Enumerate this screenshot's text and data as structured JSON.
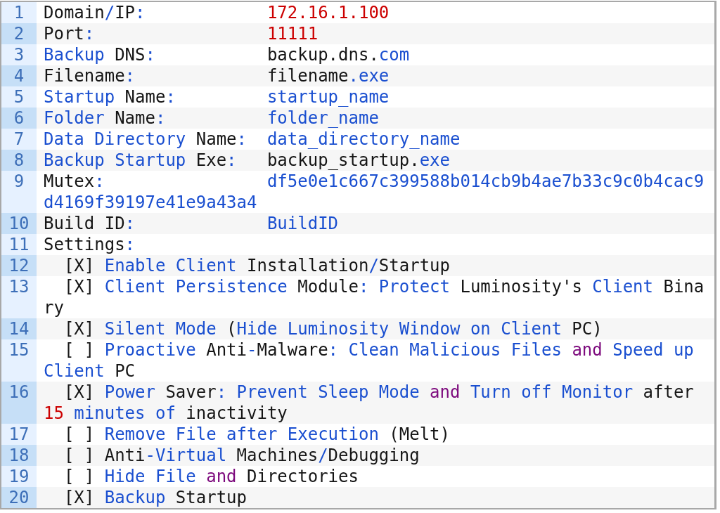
{
  "lines": [
    {
      "number": "1",
      "rows": [
        {
          "tokens": [
            {
              "kind": "plain",
              "text": "Domain"
            },
            {
              "kind": "keyword",
              "text": "/"
            },
            {
              "kind": "plain",
              "text": "IP"
            },
            {
              "kind": "keyword",
              "text": ":"
            },
            {
              "kind": "number",
              "text": "            172.16.1.100"
            }
          ]
        }
      ]
    },
    {
      "number": "2",
      "rows": [
        {
          "tokens": [
            {
              "kind": "plain",
              "text": "Port"
            },
            {
              "kind": "keyword",
              "text": ":"
            },
            {
              "kind": "number",
              "text": "                 11111"
            }
          ]
        }
      ]
    },
    {
      "number": "3",
      "rows": [
        {
          "tokens": [
            {
              "kind": "keyword",
              "text": "Backup"
            },
            {
              "kind": "plain",
              "text": " DNS"
            },
            {
              "kind": "keyword",
              "text": ":"
            },
            {
              "kind": "plain",
              "text": "           backup.dns."
            },
            {
              "kind": "keyword",
              "text": "com"
            }
          ]
        }
      ]
    },
    {
      "number": "4",
      "rows": [
        {
          "tokens": [
            {
              "kind": "plain",
              "text": "Filename"
            },
            {
              "kind": "keyword",
              "text": ":"
            },
            {
              "kind": "plain",
              "text": "             filename"
            },
            {
              "kind": "keyword",
              "text": ".exe"
            }
          ]
        }
      ]
    },
    {
      "number": "5",
      "rows": [
        {
          "tokens": [
            {
              "kind": "keyword",
              "text": "Startup"
            },
            {
              "kind": "plain",
              "text": " Name"
            },
            {
              "kind": "keyword",
              "text": ":"
            },
            {
              "kind": "keyword",
              "text": "         startup_name"
            }
          ]
        }
      ]
    },
    {
      "number": "6",
      "rows": [
        {
          "tokens": [
            {
              "kind": "keyword",
              "text": "Folder"
            },
            {
              "kind": "plain",
              "text": " Name"
            },
            {
              "kind": "keyword",
              "text": ":"
            },
            {
              "kind": "keyword",
              "text": "          folder_name"
            }
          ]
        }
      ]
    },
    {
      "number": "7",
      "rows": [
        {
          "tokens": [
            {
              "kind": "keyword",
              "text": "Data Directory"
            },
            {
              "kind": "plain",
              "text": " Name"
            },
            {
              "kind": "keyword",
              "text": ":"
            },
            {
              "kind": "keyword",
              "text": "  data_directory_name"
            }
          ]
        }
      ]
    },
    {
      "number": "8",
      "rows": [
        {
          "tokens": [
            {
              "kind": "keyword",
              "text": "Backup Startup"
            },
            {
              "kind": "plain",
              "text": " Exe"
            },
            {
              "kind": "keyword",
              "text": ":"
            },
            {
              "kind": "plain",
              "text": "   backup_startup."
            },
            {
              "kind": "keyword",
              "text": "exe"
            }
          ]
        }
      ]
    },
    {
      "number": "9",
      "rows": [
        {
          "tokens": [
            {
              "kind": "plain",
              "text": "Mutex"
            },
            {
              "kind": "keyword",
              "text": ":"
            },
            {
              "kind": "keyword",
              "text": "                df5e0e1c667c399588b014cb9b4ae7b33c9c0b4cac9"
            }
          ]
        },
        {
          "tokens": [
            {
              "kind": "keyword",
              "text": "d4169f39197e41e9a43a4"
            }
          ]
        }
      ]
    },
    {
      "number": "10",
      "rows": [
        {
          "tokens": [
            {
              "kind": "plain",
              "text": "Build ID"
            },
            {
              "kind": "keyword",
              "text": ":"
            },
            {
              "kind": "keyword",
              "text": "             BuildID"
            }
          ]
        }
      ]
    },
    {
      "number": "11",
      "rows": [
        {
          "tokens": [
            {
              "kind": "plain",
              "text": "Settings"
            },
            {
              "kind": "keyword",
              "text": ":"
            }
          ]
        }
      ]
    },
    {
      "number": "12",
      "rows": [
        {
          "tokens": [
            {
              "kind": "plain",
              "text": "  [X]"
            },
            {
              "kind": "keyword",
              "text": " Enable Client"
            },
            {
              "kind": "plain",
              "text": " Installation"
            },
            {
              "kind": "keyword",
              "text": "/"
            },
            {
              "kind": "plain",
              "text": "Startup"
            }
          ]
        }
      ]
    },
    {
      "number": "13",
      "rows": [
        {
          "tokens": [
            {
              "kind": "plain",
              "text": "  [X]"
            },
            {
              "kind": "keyword",
              "text": " Client Persistence"
            },
            {
              "kind": "plain",
              "text": " Module"
            },
            {
              "kind": "keyword",
              "text": ":"
            },
            {
              "kind": "keyword",
              "text": " Protect"
            },
            {
              "kind": "plain",
              "text": " Luminosity's"
            },
            {
              "kind": "keyword",
              "text": " Client"
            },
            {
              "kind": "plain",
              "text": " Bina"
            }
          ]
        },
        {
          "tokens": [
            {
              "kind": "plain",
              "text": "ry"
            }
          ]
        }
      ]
    },
    {
      "number": "14",
      "rows": [
        {
          "tokens": [
            {
              "kind": "plain",
              "text": "  [X]"
            },
            {
              "kind": "keyword",
              "text": " Silent Mode"
            },
            {
              "kind": "plain",
              "text": " ("
            },
            {
              "kind": "keyword",
              "text": "Hide Luminosity Window on Client"
            },
            {
              "kind": "plain",
              "text": " PC)"
            }
          ]
        }
      ]
    },
    {
      "number": "15",
      "rows": [
        {
          "tokens": [
            {
              "kind": "plain",
              "text": "  [ ]"
            },
            {
              "kind": "keyword",
              "text": " Proactive"
            },
            {
              "kind": "plain",
              "text": " Anti"
            },
            {
              "kind": "keyword",
              "text": "-"
            },
            {
              "kind": "plain",
              "text": "Malware"
            },
            {
              "kind": "keyword",
              "text": ":"
            },
            {
              "kind": "keyword",
              "text": " Clean Malicious Files"
            },
            {
              "kind": "operator",
              "text": " and"
            },
            {
              "kind": "keyword",
              "text": " Speed up"
            }
          ]
        },
        {
          "tokens": [
            {
              "kind": "keyword",
              "text": "Client"
            },
            {
              "kind": "plain",
              "text": " PC"
            }
          ]
        }
      ]
    },
    {
      "number": "16",
      "rows": [
        {
          "tokens": [
            {
              "kind": "plain",
              "text": "  [X]"
            },
            {
              "kind": "keyword",
              "text": " Power"
            },
            {
              "kind": "plain",
              "text": " Saver"
            },
            {
              "kind": "keyword",
              "text": ":"
            },
            {
              "kind": "keyword",
              "text": " Prevent Sleep Mode"
            },
            {
              "kind": "operator",
              "text": " and"
            },
            {
              "kind": "keyword",
              "text": " Turn off Monitor"
            },
            {
              "kind": "plain",
              "text": " after"
            }
          ]
        },
        {
          "tokens": [
            {
              "kind": "number",
              "text": "15"
            },
            {
              "kind": "keyword",
              "text": " minutes of"
            },
            {
              "kind": "plain",
              "text": " inactivity"
            }
          ]
        }
      ]
    },
    {
      "number": "17",
      "rows": [
        {
          "tokens": [
            {
              "kind": "plain",
              "text": "  [ ]"
            },
            {
              "kind": "keyword",
              "text": " Remove File after Execution"
            },
            {
              "kind": "plain",
              "text": " (Melt)"
            }
          ]
        }
      ]
    },
    {
      "number": "18",
      "rows": [
        {
          "tokens": [
            {
              "kind": "plain",
              "text": "  [ ] Anti"
            },
            {
              "kind": "keyword",
              "text": "-Virtual"
            },
            {
              "kind": "plain",
              "text": " Machines"
            },
            {
              "kind": "keyword",
              "text": "/"
            },
            {
              "kind": "plain",
              "text": "Debugging"
            }
          ]
        }
      ]
    },
    {
      "number": "19",
      "rows": [
        {
          "tokens": [
            {
              "kind": "plain",
              "text": "  [ ]"
            },
            {
              "kind": "keyword",
              "text": " Hide File"
            },
            {
              "kind": "operator",
              "text": " and"
            },
            {
              "kind": "plain",
              "text": " Directories"
            }
          ]
        }
      ]
    },
    {
      "number": "20",
      "rows": [
        {
          "tokens": [
            {
              "kind": "plain",
              "text": "  [X]"
            },
            {
              "kind": "keyword",
              "text": " Backup"
            },
            {
              "kind": "plain",
              "text": " Startup"
            }
          ]
        }
      ]
    }
  ]
}
